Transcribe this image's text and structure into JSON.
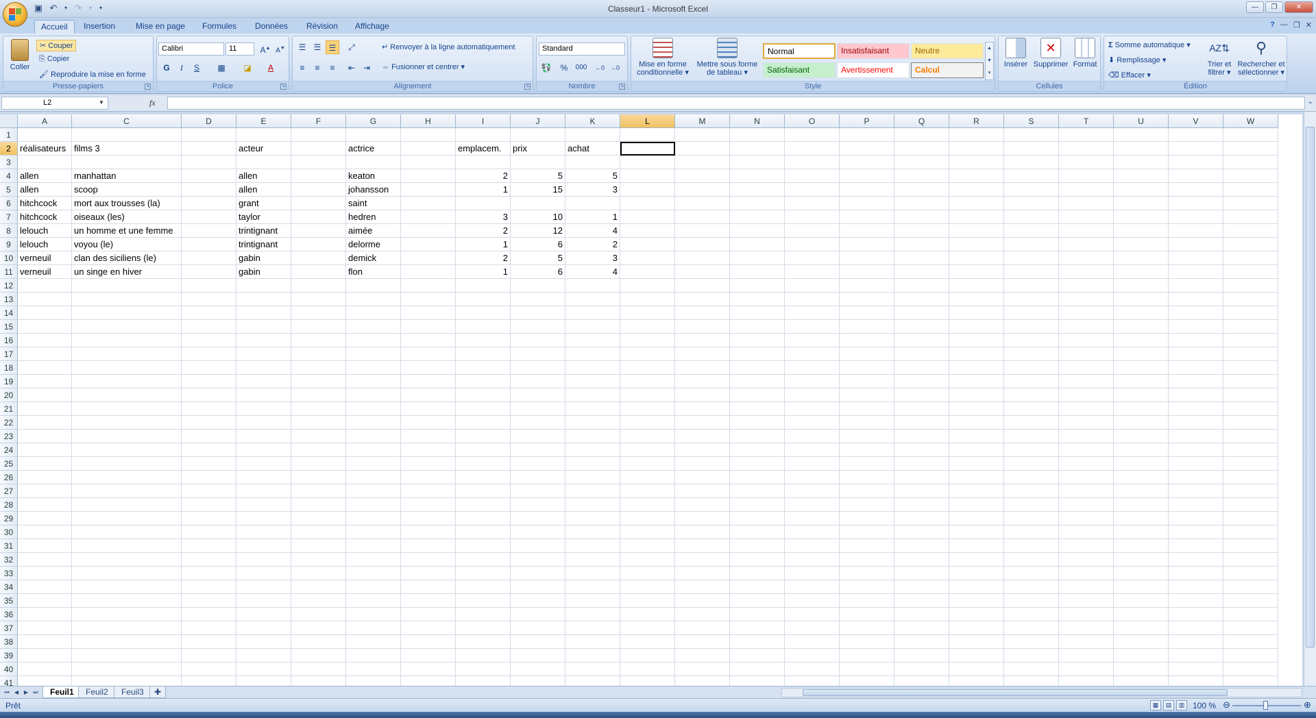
{
  "window": {
    "title": "Classeur1 - Microsoft Excel"
  },
  "tabs": [
    "Accueil",
    "Insertion",
    "Mise en page",
    "Formules",
    "Données",
    "Révision",
    "Affichage"
  ],
  "ribbon": {
    "clipboard": {
      "paste": "Coller",
      "cut": "Couper",
      "copy": "Copier",
      "format_painter": "Reproduire la mise en forme",
      "label": "Presse-papiers"
    },
    "font": {
      "name": "Calibri",
      "size": "11",
      "label": "Police",
      "bold": "G",
      "italic": "I",
      "underline": "S"
    },
    "alignment": {
      "wrap": "Renvoyer à la ligne automatiquement",
      "merge": "Fusionner et centrer",
      "label": "Alignement"
    },
    "number": {
      "format": "Standard",
      "percent": "%",
      "thousands": "000",
      "label": "Nombre"
    },
    "styles": {
      "cond_format": "Mise en forme conditionnelle",
      "table_format": "Mettre sous forme de tableau",
      "normal": "Normal",
      "bad": "Insatisfaisant",
      "neutral": "Neutre",
      "good": "Satisfaisant",
      "warning": "Avertissement",
      "calc": "Calcul",
      "label": "Style"
    },
    "cells": {
      "insert": "Insérer",
      "delete": "Supprimer",
      "format": "Format",
      "label": "Cellules"
    },
    "editing": {
      "autosum": "Somme automatique",
      "fill": "Remplissage",
      "clear": "Effacer",
      "sort": "Trier et filtrer",
      "find": "Rechercher et sélectionner",
      "label": "Édition"
    }
  },
  "formula_bar": {
    "name_box": "L2",
    "fx": "fx",
    "formula": ""
  },
  "columns": [
    {
      "id": "A"
    },
    {
      "id": "C"
    },
    {
      "id": "D"
    },
    {
      "id": "E"
    },
    {
      "id": "F"
    },
    {
      "id": "G"
    },
    {
      "id": "H"
    },
    {
      "id": "I"
    },
    {
      "id": "J"
    },
    {
      "id": "K"
    },
    {
      "id": "L"
    },
    {
      "id": "M"
    },
    {
      "id": "N"
    },
    {
      "id": "O"
    },
    {
      "id": "P"
    },
    {
      "id": "Q"
    },
    {
      "id": "R"
    },
    {
      "id": "S"
    },
    {
      "id": "T"
    },
    {
      "id": "U"
    },
    {
      "id": "V"
    },
    {
      "id": "W"
    }
  ],
  "selected_cell": {
    "col": "L",
    "row": 2
  },
  "cells": [
    {
      "row": 2,
      "col": "A",
      "v": "réalisateurs"
    },
    {
      "row": 2,
      "col": "C",
      "v": "films 3"
    },
    {
      "row": 2,
      "col": "E",
      "v": "acteur"
    },
    {
      "row": 2,
      "col": "G",
      "v": "actrice"
    },
    {
      "row": 2,
      "col": "I",
      "v": "emplacem."
    },
    {
      "row": 2,
      "col": "J",
      "v": "prix"
    },
    {
      "row": 2,
      "col": "K",
      "v": "achat"
    },
    {
      "row": 4,
      "col": "A",
      "v": "allen"
    },
    {
      "row": 4,
      "col": "C",
      "v": "manhattan"
    },
    {
      "row": 4,
      "col": "E",
      "v": "allen"
    },
    {
      "row": 4,
      "col": "G",
      "v": "keaton"
    },
    {
      "row": 4,
      "col": "I",
      "v": "2",
      "n": true
    },
    {
      "row": 4,
      "col": "J",
      "v": "5",
      "n": true
    },
    {
      "row": 4,
      "col": "K",
      "v": "5",
      "n": true
    },
    {
      "row": 5,
      "col": "A",
      "v": "allen"
    },
    {
      "row": 5,
      "col": "C",
      "v": "scoop"
    },
    {
      "row": 5,
      "col": "E",
      "v": "allen"
    },
    {
      "row": 5,
      "col": "G",
      "v": "johansson"
    },
    {
      "row": 5,
      "col": "I",
      "v": "1",
      "n": true
    },
    {
      "row": 5,
      "col": "J",
      "v": "15",
      "n": true
    },
    {
      "row": 5,
      "col": "K",
      "v": "3",
      "n": true
    },
    {
      "row": 6,
      "col": "A",
      "v": "hitchcock"
    },
    {
      "row": 6,
      "col": "C",
      "v": "mort aux trousses (la)"
    },
    {
      "row": 6,
      "col": "E",
      "v": "grant"
    },
    {
      "row": 6,
      "col": "G",
      "v": "saint"
    },
    {
      "row": 7,
      "col": "A",
      "v": "hitchcock"
    },
    {
      "row": 7,
      "col": "C",
      "v": "oiseaux (les)"
    },
    {
      "row": 7,
      "col": "E",
      "v": "taylor"
    },
    {
      "row": 7,
      "col": "G",
      "v": "hedren"
    },
    {
      "row": 7,
      "col": "I",
      "v": "3",
      "n": true
    },
    {
      "row": 7,
      "col": "J",
      "v": "10",
      "n": true
    },
    {
      "row": 7,
      "col": "K",
      "v": "1",
      "n": true
    },
    {
      "row": 8,
      "col": "A",
      "v": "lelouch"
    },
    {
      "row": 8,
      "col": "C",
      "v": "un homme et une femme"
    },
    {
      "row": 8,
      "col": "E",
      "v": "trintignant"
    },
    {
      "row": 8,
      "col": "G",
      "v": "aimée"
    },
    {
      "row": 8,
      "col": "I",
      "v": "2",
      "n": true
    },
    {
      "row": 8,
      "col": "J",
      "v": "12",
      "n": true
    },
    {
      "row": 8,
      "col": "K",
      "v": "4",
      "n": true
    },
    {
      "row": 9,
      "col": "A",
      "v": "lelouch"
    },
    {
      "row": 9,
      "col": "C",
      "v": "voyou (le)"
    },
    {
      "row": 9,
      "col": "E",
      "v": "trintignant"
    },
    {
      "row": 9,
      "col": "G",
      "v": "delorme"
    },
    {
      "row": 9,
      "col": "I",
      "v": "1",
      "n": true
    },
    {
      "row": 9,
      "col": "J",
      "v": "6",
      "n": true
    },
    {
      "row": 9,
      "col": "K",
      "v": "2",
      "n": true
    },
    {
      "row": 10,
      "col": "A",
      "v": "verneuil"
    },
    {
      "row": 10,
      "col": "C",
      "v": "clan des siciliens (le)"
    },
    {
      "row": 10,
      "col": "E",
      "v": "gabin"
    },
    {
      "row": 10,
      "col": "G",
      "v": "demick"
    },
    {
      "row": 10,
      "col": "I",
      "v": "2",
      "n": true
    },
    {
      "row": 10,
      "col": "J",
      "v": "5",
      "n": true
    },
    {
      "row": 10,
      "col": "K",
      "v": "3",
      "n": true
    },
    {
      "row": 11,
      "col": "A",
      "v": "verneuil"
    },
    {
      "row": 11,
      "col": "C",
      "v": "un singe en hiver"
    },
    {
      "row": 11,
      "col": "E",
      "v": "gabin"
    },
    {
      "row": 11,
      "col": "G",
      "v": "flon"
    },
    {
      "row": 11,
      "col": "I",
      "v": "1",
      "n": true
    },
    {
      "row": 11,
      "col": "J",
      "v": "6",
      "n": true
    },
    {
      "row": 11,
      "col": "K",
      "v": "4",
      "n": true
    }
  ],
  "row_count": 41,
  "sheets": [
    "Feuil1",
    "Feuil2",
    "Feuil3"
  ],
  "active_sheet": "Feuil1",
  "status": {
    "text": "Prêt",
    "zoom": "100 %"
  }
}
